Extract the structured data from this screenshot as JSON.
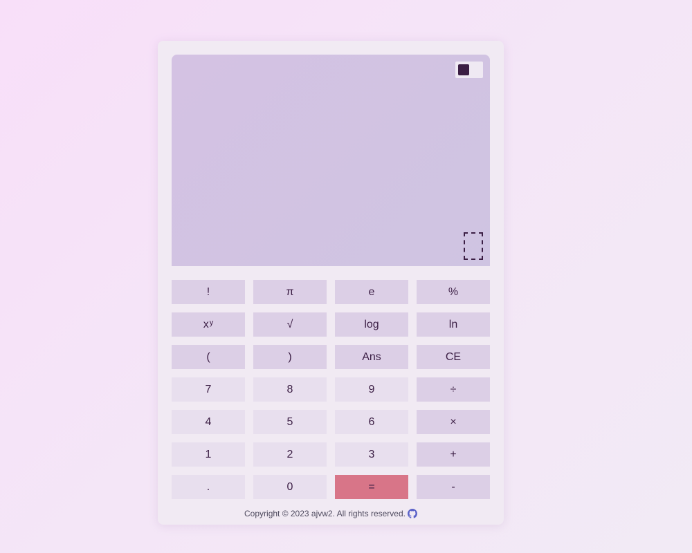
{
  "display": {
    "toggle_knob_color": "#3b1e44"
  },
  "keys": {
    "factorial": "!",
    "pi": "π",
    "e": "e",
    "percent": "%",
    "power_base": "x",
    "power_exp": "y",
    "sqrt": "√",
    "log": "log",
    "ln": "ln",
    "lparen": "(",
    "rparen": ")",
    "ans": "Ans",
    "ce": "CE",
    "seven": "7",
    "eight": "8",
    "nine": "9",
    "divide": "÷",
    "four": "4",
    "five": "5",
    "six": "6",
    "multiply": "×",
    "one": "1",
    "two": "2",
    "three": "3",
    "plus": "+",
    "dot": ".",
    "zero": "0",
    "equals": "=",
    "minus": "-"
  },
  "colors": {
    "background": "#f5e4f7",
    "panel": "#f1eaf3",
    "display": "#d2c3e3",
    "function_key": "#dccfe6",
    "number_key": "#e8dfee",
    "equals_key": "#d87588",
    "text": "#3b1e44"
  },
  "footer": {
    "copyright": "Copyright © 2023 ajvw2. All rights reserved.",
    "icon": "github-icon"
  }
}
